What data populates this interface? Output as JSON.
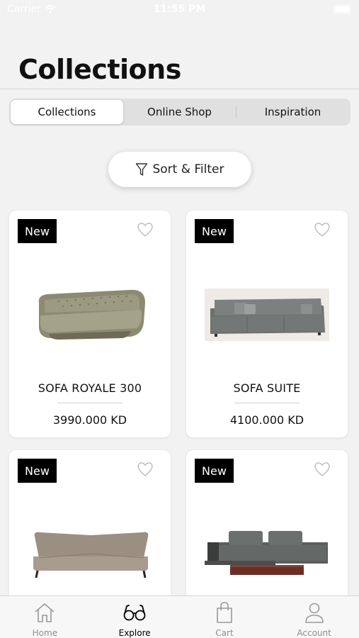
{
  "status_bar": {
    "carrier": "Carrier",
    "time": "11:55 PM"
  },
  "page": {
    "title": "Collections"
  },
  "segments": [
    {
      "label": "Collections",
      "active": true
    },
    {
      "label": "Online Shop",
      "active": false
    },
    {
      "label": "Inspiration",
      "active": false
    }
  ],
  "sort_filter": {
    "label": "Sort & Filter",
    "icon": "funnel-icon"
  },
  "products": [
    {
      "badge": "New",
      "name": "SOFA ROYALE 300",
      "price": "3990.000 KD"
    },
    {
      "badge": "New",
      "name": "SOFA SUITE",
      "price": "4100.000 KD"
    },
    {
      "badge": "New"
    },
    {
      "badge": "New"
    }
  ],
  "tab_bar": {
    "items": [
      {
        "label": "Home",
        "icon": "home-icon",
        "active": false
      },
      {
        "label": "Explore",
        "icon": "glasses-icon",
        "active": true
      },
      {
        "label": "Cart",
        "icon": "shopping-bag-icon",
        "active": false
      },
      {
        "label": "Account",
        "icon": "user-icon",
        "active": false
      }
    ]
  },
  "colors": {
    "badge_bg": "#000000",
    "background": "#f2f2f2",
    "inactive_tab": "#8e8e8e"
  }
}
